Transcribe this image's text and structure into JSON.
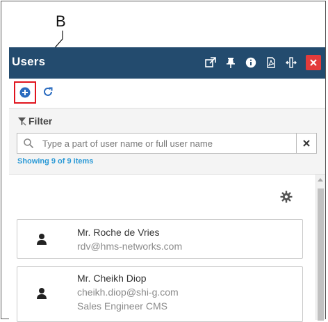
{
  "annotation": {
    "label": "B"
  },
  "header": {
    "title": "Users",
    "icons": [
      "external-link-icon",
      "pin-icon",
      "info-icon",
      "pdf-icon",
      "resize-icon",
      "close-icon"
    ],
    "close_color": "#e33b3b",
    "bar_color": "#234b6e"
  },
  "toolbar": {
    "add_icon": "plus-circle-icon",
    "refresh_icon": "refresh-icon",
    "highlight_color": "#e0141e"
  },
  "filter": {
    "title": "Filter",
    "placeholder": "Type a part of user name or full user name",
    "value": "",
    "showing_text": "Showing 9 of 9 items"
  },
  "users": [
    {
      "name": "Mr. Roche de Vries",
      "email": "rdv@hms-networks.com",
      "role": ""
    },
    {
      "name": "Mr. Cheikh Diop",
      "email": "cheikh.diop@shi-g.com",
      "role": "Sales Engineer CMS"
    }
  ]
}
